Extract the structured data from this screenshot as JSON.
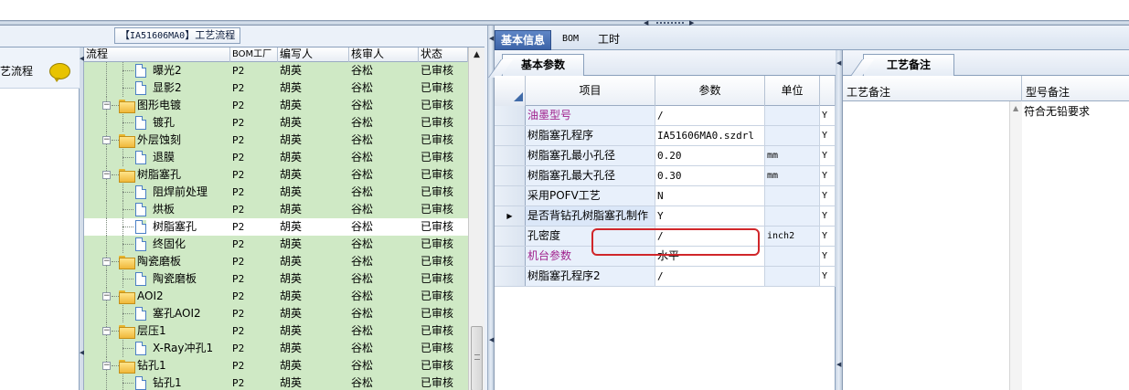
{
  "window": {
    "process_title_code": "IA51606MA0",
    "process_title_prefix": "【",
    "process_title_suffix": "】工艺流程"
  },
  "left_panel": {
    "flow_label": "艺流程",
    "tree_headers": {
      "flow": "流程",
      "bom_factory": "BOM工厂",
      "writer": "编写人",
      "reviewer": "核审人",
      "status": "状态"
    },
    "rows": [
      {
        "level": 2,
        "type": "doc",
        "name": "曝光2",
        "factory": "P2",
        "writer": "胡英",
        "reviewer": "谷松",
        "status": "已审核"
      },
      {
        "level": 2,
        "type": "doc",
        "name": "显影2",
        "factory": "P2",
        "writer": "胡英",
        "reviewer": "谷松",
        "status": "已审核"
      },
      {
        "level": 1,
        "type": "folder",
        "name": "图形电镀",
        "factory": "P2",
        "writer": "胡英",
        "reviewer": "谷松",
        "status": "已审核"
      },
      {
        "level": 2,
        "type": "doc",
        "name": "镀孔",
        "factory": "P2",
        "writer": "胡英",
        "reviewer": "谷松",
        "status": "已审核"
      },
      {
        "level": 1,
        "type": "folder",
        "name": "外层蚀刻",
        "factory": "P2",
        "writer": "胡英",
        "reviewer": "谷松",
        "status": "已审核"
      },
      {
        "level": 2,
        "type": "doc",
        "name": "退膜",
        "factory": "P2",
        "writer": "胡英",
        "reviewer": "谷松",
        "status": "已审核"
      },
      {
        "level": 1,
        "type": "folder",
        "name": "树脂塞孔",
        "factory": "P2",
        "writer": "胡英",
        "reviewer": "谷松",
        "status": "已审核"
      },
      {
        "level": 2,
        "type": "doc",
        "name": "阻焊前处理",
        "factory": "P2",
        "writer": "胡英",
        "reviewer": "谷松",
        "status": "已审核"
      },
      {
        "level": 2,
        "type": "doc",
        "name": "烘板",
        "factory": "P2",
        "writer": "胡英",
        "reviewer": "谷松",
        "status": "已审核"
      },
      {
        "level": 2,
        "type": "doc",
        "name": "树脂塞孔",
        "factory": "P2",
        "writer": "胡英",
        "reviewer": "谷松",
        "status": "已审核",
        "selected": true
      },
      {
        "level": 2,
        "type": "doc",
        "name": "终固化",
        "factory": "P2",
        "writer": "胡英",
        "reviewer": "谷松",
        "status": "已审核"
      },
      {
        "level": 1,
        "type": "folder",
        "name": "陶瓷磨板",
        "factory": "P2",
        "writer": "胡英",
        "reviewer": "谷松",
        "status": "已审核"
      },
      {
        "level": 2,
        "type": "doc",
        "name": "陶瓷磨板",
        "factory": "P2",
        "writer": "胡英",
        "reviewer": "谷松",
        "status": "已审核"
      },
      {
        "level": 1,
        "type": "folder",
        "name": "AOI2",
        "factory": "P2",
        "writer": "胡英",
        "reviewer": "谷松",
        "status": "已审核"
      },
      {
        "level": 2,
        "type": "doc",
        "name": "塞孔AOI2",
        "factory": "P2",
        "writer": "胡英",
        "reviewer": "谷松",
        "status": "已审核"
      },
      {
        "level": 1,
        "type": "folder",
        "name": "层压1",
        "factory": "P2",
        "writer": "胡英",
        "reviewer": "谷松",
        "status": "已审核"
      },
      {
        "level": 2,
        "type": "doc",
        "name": "X-Ray冲孔1",
        "factory": "P2",
        "writer": "胡英",
        "reviewer": "谷松",
        "status": "已审核"
      },
      {
        "level": 1,
        "type": "folder",
        "name": "钻孔1",
        "factory": "P2",
        "writer": "胡英",
        "reviewer": "谷松",
        "status": "已审核"
      },
      {
        "level": 2,
        "type": "doc",
        "name": "钻孔1",
        "factory": "P2",
        "writer": "胡英",
        "reviewer": "谷松",
        "status": "已审核"
      }
    ]
  },
  "main_tabs": [
    {
      "label": "基本信息",
      "active": true
    },
    {
      "label": "BOM",
      "active": false
    },
    {
      "label": "工时",
      "active": false
    }
  ],
  "params": {
    "sub_tab": "基本参数",
    "headers": {
      "item": "项目",
      "param": "参数",
      "unit": "单位"
    },
    "rows": [
      {
        "item": "油墨型号",
        "value": "/",
        "unit": "",
        "flag": "Y",
        "pink": true
      },
      {
        "item": "树脂塞孔程序",
        "value": "IA51606MA0.szdrl",
        "unit": "",
        "flag": "Y"
      },
      {
        "item": "树脂塞孔最小孔径",
        "value": "0.20",
        "unit": "mm",
        "flag": "Y"
      },
      {
        "item": "树脂塞孔最大孔径",
        "value": "0.30",
        "unit": "mm",
        "flag": "Y"
      },
      {
        "item": "采用POFV工艺",
        "value": "N",
        "unit": "",
        "flag": "Y"
      },
      {
        "item": "是否背钻孔树脂塞孔制作",
        "value": "Y",
        "unit": "",
        "flag": "Y",
        "current": true
      },
      {
        "item": "孔密度",
        "value": "/",
        "unit": "inch2",
        "flag": "Y"
      },
      {
        "item": "机台参数",
        "value": "水平",
        "unit": "",
        "flag": "Y",
        "pink": true,
        "cjk": true
      },
      {
        "item": "树脂塞孔程序2",
        "value": "/",
        "unit": "",
        "flag": "Y"
      }
    ],
    "current_row_marker": "▶"
  },
  "notes": {
    "tab": "工艺备注",
    "headers": {
      "process_note": "工艺备注",
      "model_note": "型号备注"
    },
    "model_note_value": "符合无铅要求"
  }
}
